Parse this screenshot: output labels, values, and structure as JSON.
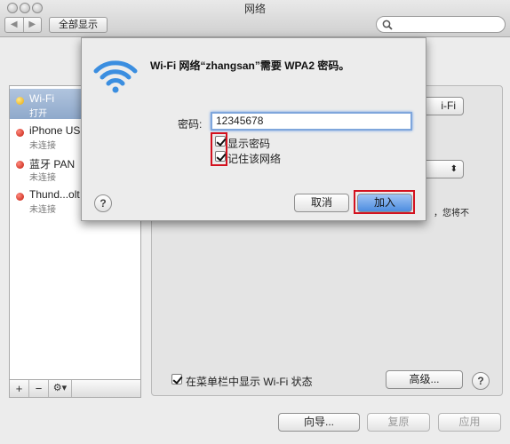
{
  "window": {
    "title": "网络",
    "back_glyph": "◀",
    "forward_glyph": "▶",
    "show_all_label": "全部显示",
    "search_placeholder": ""
  },
  "sidebar": {
    "items": [
      {
        "name": "Wi-Fi",
        "status": "打开",
        "indicator": "#e7a70b",
        "selected": true
      },
      {
        "name": "iPhone USB",
        "status": "未连接",
        "indicator": "#c21a0b",
        "selected": false
      },
      {
        "name": "蓝牙 PAN",
        "status": "未连接",
        "indicator": "#c21a0b",
        "selected": false
      },
      {
        "name": "Thund...olt",
        "status": "未连接",
        "indicator": "#c21a0b",
        "selected": false
      }
    ],
    "toolbar": {
      "add": "+",
      "remove": "−",
      "gear": "⚙▾"
    }
  },
  "panel": {
    "wifi_button_label": "i-Fi",
    "stepper_glyph": "⬍",
    "partial_text": "，您将不",
    "show_status_label": "在菜单栏中显示 Wi-Fi 状态",
    "advanced_label": "高级...",
    "help_label": "?"
  },
  "footer": {
    "assist_label": "向导...",
    "revert_label": "复原",
    "apply_label": "应用"
  },
  "dialog": {
    "title": "Wi-Fi 网络“zhangsan”需要 WPA2 密码。",
    "password_label": "密码:",
    "password_value": "12345678",
    "show_password_label": "显示密码",
    "remember_network_label": "记住该网络",
    "help_label": "?",
    "cancel_label": "取消",
    "join_label": "加入"
  },
  "colors": {
    "wifi_icon": "#3b8ee0",
    "highlight_box": "#d3121f",
    "join_button": "#4d8de0",
    "selected_row": "#8fa9cb"
  },
  "icons": {
    "wifi": "wifi-icon",
    "search": "search-icon",
    "gear": "gear-icon",
    "help": "help-icon"
  }
}
